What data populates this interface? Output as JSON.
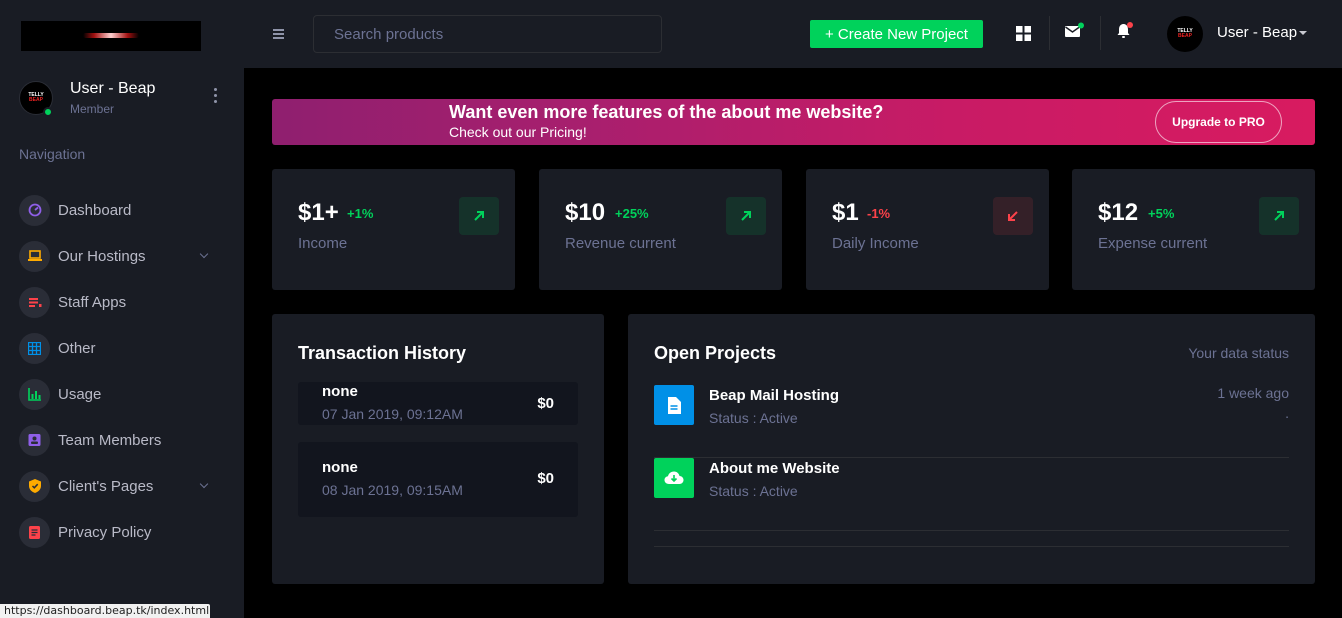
{
  "sidebar": {
    "profile": {
      "name": "User - Beap",
      "role": "Member",
      "avatar_text_top": "TELLY",
      "avatar_text_bottom": "BEAP"
    },
    "nav_title": "Navigation",
    "items": [
      {
        "label": "Dashboard",
        "icon": "speedometer-icon",
        "color": "#8f5fe8"
      },
      {
        "label": "Our Hostings",
        "icon": "laptop-icon",
        "color": "#ffab00"
      },
      {
        "label": "Staff Apps",
        "icon": "playlist-icon",
        "color": "#fc424a"
      },
      {
        "label": "Other",
        "icon": "table-icon",
        "color": "#0090e7"
      },
      {
        "label": "Usage",
        "icon": "chart-bar-icon",
        "color": "#00d25b"
      },
      {
        "label": "Team Members",
        "icon": "contacts-icon",
        "color": "#8f5fe8"
      },
      {
        "label": "Client's Pages",
        "icon": "shield-icon",
        "color": "#ffab00"
      },
      {
        "label": "Privacy Policy",
        "icon": "file-document-icon",
        "color": "#fc424a"
      }
    ]
  },
  "status_url": "https://dashboard.beap.tk/index.html",
  "navbar": {
    "search_placeholder": "Search products",
    "create_label": "+ Create New Project",
    "user_name": "User - Beap"
  },
  "banner": {
    "title": "Want even more features of the about me website?",
    "subtitle": "Check out our Pricing!",
    "button": "Upgrade to PRO"
  },
  "stats": [
    {
      "value": "$1+",
      "change": "+1%",
      "label": "Income",
      "trend": "up"
    },
    {
      "value": "$10",
      "change": "+25%",
      "label": "Revenue current",
      "trend": "up"
    },
    {
      "value": "$1",
      "change": "-1%",
      "label": "Daily Income",
      "trend": "down"
    },
    {
      "value": "$12",
      "change": "+5%",
      "label": "Expense current",
      "trend": "up"
    }
  ],
  "transactions": {
    "title": "Transaction History",
    "items": [
      {
        "name": "none",
        "date": "07 Jan 2019, 09:12AM",
        "amount": "$0"
      },
      {
        "name": "none",
        "date": "08 Jan 2019, 09:15AM",
        "amount": "$0"
      }
    ]
  },
  "projects": {
    "title": "Open Projects",
    "hint": "Your data status",
    "items": [
      {
        "name": "Beap Mail Hosting",
        "status": "Status : Active",
        "time": "1 week ago",
        "extra": ".",
        "icon": "file-icon",
        "color": "#0090e7"
      },
      {
        "name": "About me Website",
        "status": "Status : Active",
        "time": "",
        "extra": "",
        "icon": "cloud-download-icon",
        "color": "#00d25b"
      }
    ]
  },
  "colors": {
    "success": "#00d25b",
    "danger": "#fc424a",
    "muted": "#6c7293",
    "card": "#191c24"
  }
}
